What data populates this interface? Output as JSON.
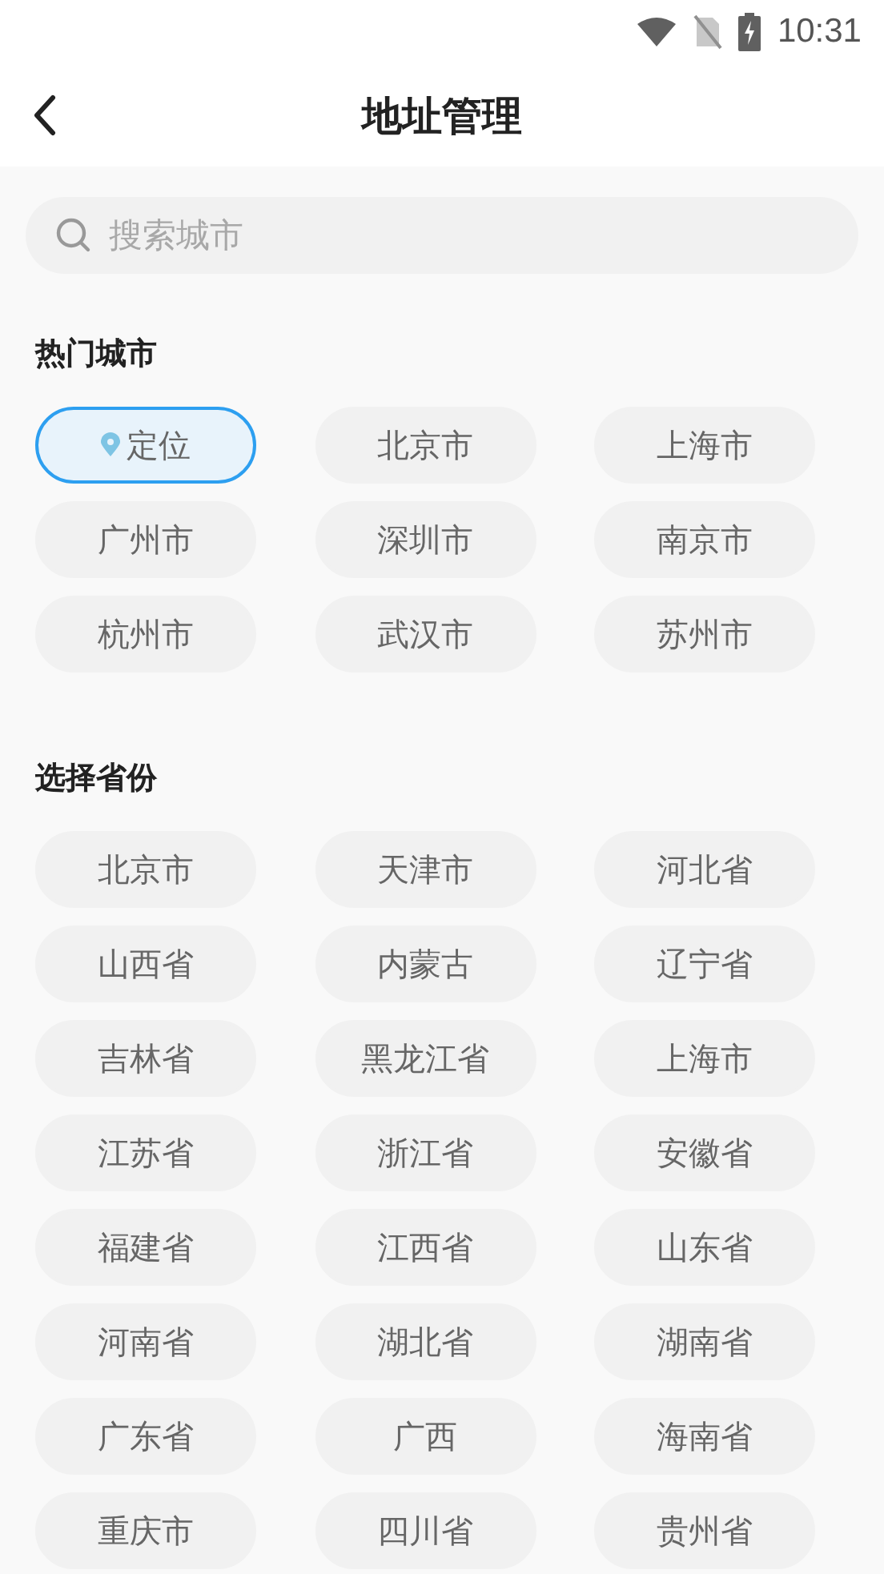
{
  "status_bar": {
    "time": "10:31"
  },
  "header": {
    "title": "地址管理"
  },
  "search": {
    "placeholder": "搜索城市"
  },
  "hot_cities": {
    "title": "热门城市",
    "items": [
      {
        "label": "定位",
        "kind": "locate",
        "selected": true
      },
      {
        "label": "北京市",
        "kind": "city",
        "selected": false
      },
      {
        "label": "上海市",
        "kind": "city",
        "selected": false
      },
      {
        "label": "广州市",
        "kind": "city",
        "selected": false
      },
      {
        "label": "深圳市",
        "kind": "city",
        "selected": false
      },
      {
        "label": "南京市",
        "kind": "city",
        "selected": false
      },
      {
        "label": "杭州市",
        "kind": "city",
        "selected": false
      },
      {
        "label": "武汉市",
        "kind": "city",
        "selected": false
      },
      {
        "label": "苏州市",
        "kind": "city",
        "selected": false
      }
    ]
  },
  "provinces": {
    "title": "选择省份",
    "items": [
      "北京市",
      "天津市",
      "河北省",
      "山西省",
      "内蒙古",
      "辽宁省",
      "吉林省",
      "黑龙江省",
      "上海市",
      "江苏省",
      "浙江省",
      "安徽省",
      "福建省",
      "江西省",
      "山东省",
      "河南省",
      "湖北省",
      "湖南省",
      "广东省",
      "广西",
      "海南省",
      "重庆市",
      "四川省",
      "贵州省"
    ]
  }
}
